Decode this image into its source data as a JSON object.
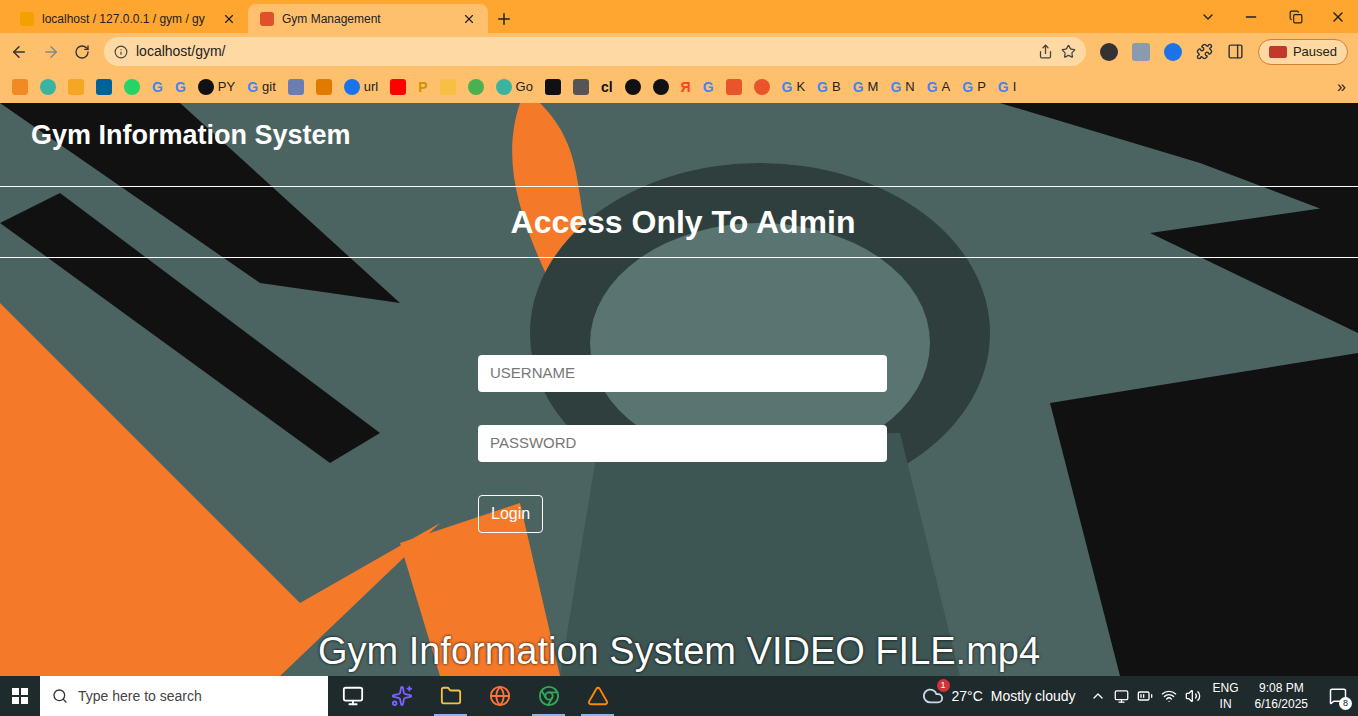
{
  "browser": {
    "tabs": [
      {
        "title": "localhost / 127.0.0.1 / gym / gy",
        "selected": false,
        "color": "#f4a100"
      },
      {
        "title": "Gym Management",
        "selected": true,
        "color": "#e0502b"
      }
    ],
    "url": "localhost/gym/",
    "profile": "Paused",
    "bookmarks": [
      {
        "kind": "tile",
        "color": "#f08a24"
      },
      {
        "kind": "circle",
        "color": "#3bb3a0"
      },
      {
        "kind": "tile",
        "color": "#f5a623"
      },
      {
        "kind": "tile",
        "color": "#00629b"
      },
      {
        "kind": "circle",
        "color": "#25d366"
      },
      {
        "kind": "letter",
        "glyph": "G",
        "color": "#4285f4"
      },
      {
        "kind": "letter",
        "glyph": "G",
        "color": "#4285f4"
      },
      {
        "kind": "circle",
        "color": "#111111",
        "label": "PY"
      },
      {
        "kind": "letter",
        "glyph": "G",
        "color": "#4285f4",
        "label": "git"
      },
      {
        "kind": "tile",
        "color": "#6b7db3"
      },
      {
        "kind": "tile",
        "color": "#e07b00"
      },
      {
        "kind": "circle",
        "color": "#1a73e8",
        "label": "url"
      },
      {
        "kind": "tile",
        "color": "#ff0000"
      },
      {
        "kind": "letter",
        "glyph": "P",
        "color": "#c89600"
      },
      {
        "kind": "tile",
        "color": "#f6c142"
      },
      {
        "kind": "circle",
        "color": "#4caf50"
      },
      {
        "kind": "circle",
        "color": "#3bb3a0",
        "label": "Go"
      },
      {
        "kind": "tile",
        "color": "#111111"
      },
      {
        "kind": "tile",
        "color": "#555555"
      },
      {
        "kind": "letter",
        "glyph": "cl",
        "color": "#111111"
      },
      {
        "kind": "circle",
        "color": "#111111"
      },
      {
        "kind": "circle",
        "color": "#111111"
      },
      {
        "kind": "letter",
        "glyph": "Я",
        "color": "#fc3f1d"
      },
      {
        "kind": "letter",
        "glyph": "G",
        "color": "#4285f4"
      },
      {
        "kind": "tile",
        "color": "#e8552a"
      },
      {
        "kind": "circle",
        "color": "#e8552a"
      },
      {
        "kind": "letter",
        "glyph": "G",
        "color": "#4285f4",
        "label": "K"
      },
      {
        "kind": "letter",
        "glyph": "G",
        "color": "#4285f4",
        "label": "B"
      },
      {
        "kind": "letter",
        "glyph": "G",
        "color": "#4285f4",
        "label": "M"
      },
      {
        "kind": "letter",
        "glyph": "G",
        "color": "#4285f4",
        "label": "N"
      },
      {
        "kind": "letter",
        "glyph": "G",
        "color": "#4285f4",
        "label": "A"
      },
      {
        "kind": "letter",
        "glyph": "G",
        "color": "#4285f4",
        "label": "P"
      },
      {
        "kind": "letter",
        "glyph": "G",
        "color": "#4285f4",
        "label": "I"
      }
    ],
    "overflow": "»"
  },
  "page": {
    "brand": "Gym Information System",
    "heading": "Access Only To Admin",
    "fields": [
      {
        "placeholder": "USERNAME",
        "kind": "text"
      },
      {
        "placeholder": "PASSWORD",
        "kind": "password"
      }
    ],
    "button": "Login",
    "caption": "Gym Information System VIDEO FILE.mp4"
  },
  "taskbar": {
    "search": "Type here to search",
    "apps": [
      {
        "kind": "taskview",
        "color": "#ffffff",
        "running": false
      },
      {
        "kind": "copilot",
        "color": "#7b61ff",
        "running": false
      },
      {
        "kind": "explorer",
        "color": "#f6c142",
        "running": true
      },
      {
        "kind": "firefox",
        "color": "#ff7139",
        "running": false
      },
      {
        "kind": "chrome",
        "color": "#34a853",
        "running": true
      },
      {
        "kind": "vlc",
        "color": "#ff8800",
        "running": true
      }
    ],
    "weather": {
      "badge": "1",
      "temp": "27°C",
      "text": "Mostly cloudy"
    },
    "language": [
      "ENG",
      "IN"
    ],
    "time": "9:08 PM",
    "date": "6/16/2025",
    "notifications": "8"
  }
}
